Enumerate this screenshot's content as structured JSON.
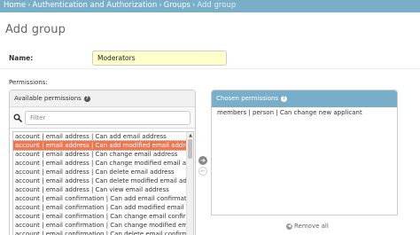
{
  "breadcrumbs": {
    "items": [
      "Home",
      "Authentication and Authorization",
      "Groups"
    ],
    "separator": "›",
    "current": "Add group"
  },
  "page_title": "Add group",
  "name_field": {
    "label": "Name:",
    "value": "Moderators"
  },
  "permissions_label": "Permissions:",
  "available": {
    "title": "Available permissions",
    "help_icon": "question-circle-icon",
    "filter_placeholder": "Filter",
    "filter_icon": "search-icon",
    "options": [
      "account | email address | Can add email address",
      "account | email address | Can add modified email address",
      "account | email address | Can change email address",
      "account | email address | Can change modified email address",
      "account | email address | Can delete email address",
      "account | email address | Can delete modified email address",
      "account | email address | Can view email address",
      "account | email confirmation | Can add email confirmation",
      "account | email confirmation | Can add modified email confirmation",
      "account | email confirmation | Can change email confirmation",
      "account | email confirmation | Can change modified email confirmation",
      "account | email confirmation | Can delete email confirmation"
    ],
    "selected_index": 1
  },
  "chosen": {
    "title": "Chosen permissions",
    "help_icon": "question-circle-icon",
    "options": [
      "members | person | Can change new applicant"
    ]
  },
  "remove_all_label": "Remove all",
  "colors": {
    "breadcrumb_bg": "#79aec8",
    "chosen_header_bg": "#79aec8",
    "selected_option_bg": "#ee7752",
    "name_input_bg": "#ffffcc"
  }
}
